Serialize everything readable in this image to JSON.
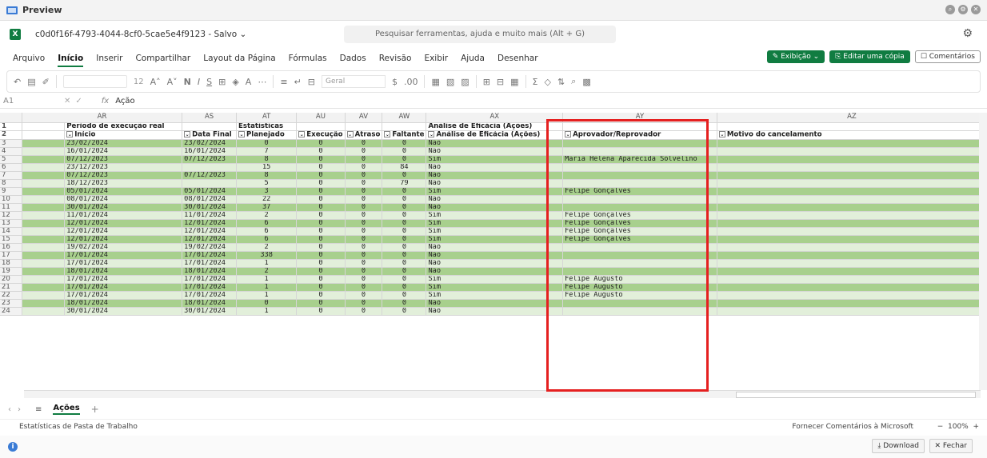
{
  "window": {
    "title": "Preview",
    "controls": [
      "zoom-icon",
      "settings-icon",
      "close-icon"
    ]
  },
  "file": {
    "name": "c0d0f16f-4793-4044-8cf0-5cae5e4f9123",
    "status": "Salvo",
    "app_icon": "X"
  },
  "search": {
    "placeholder": "Pesquisar ferramentas, ajuda e muito mais (Alt + G)"
  },
  "menu": {
    "items": [
      "Arquivo",
      "Início",
      "Inserir",
      "Compartilhar",
      "Layout da Página",
      "Fórmulas",
      "Dados",
      "Revisão",
      "Exibir",
      "Ajuda",
      "Desenhar"
    ],
    "active_index": 1,
    "exibicao": "Exibição",
    "editar": "Editar uma cópia",
    "comentarios": "Comentários"
  },
  "ribbon": {
    "font_size": "12",
    "number_format": "Geral"
  },
  "formula": {
    "cell": "A1",
    "fx": "fx",
    "value": "Ação"
  },
  "sheet": {
    "columns": [
      "AR",
      "AS",
      "AT",
      "AU",
      "AV",
      "AW",
      "AX",
      "AY",
      "AZ"
    ],
    "header1": {
      "ar": "Período de execução real",
      "at": "Estatísticas",
      "ax": "Análise de Eficácia (Ações)"
    },
    "header2": {
      "ar": "Início",
      "as": "Data Final",
      "at": "Planejado",
      "au": "Execução",
      "av": "Atraso",
      "aw": "Faltante",
      "ax": "Análise de Eficácia (Ações)",
      "ay": "Aprovador/Reprovador",
      "az": "Motivo do cancelamento"
    },
    "rows": [
      {
        "n": "3",
        "ar": "23/02/2024",
        "as": "23/02/2024",
        "at": "0",
        "au": "0",
        "av": "0",
        "aw": "0",
        "ax": "Não",
        "ay": ""
      },
      {
        "n": "4",
        "ar": "16/01/2024",
        "as": "16/01/2024",
        "at": "7",
        "au": "0",
        "av": "0",
        "aw": "0",
        "ax": "Não",
        "ay": ""
      },
      {
        "n": "5",
        "ar": "07/12/2023",
        "as": "07/12/2023",
        "at": "8",
        "au": "0",
        "av": "0",
        "aw": "0",
        "ax": "Sim",
        "ay": "Maria Helena Aparecida Solvelino"
      },
      {
        "n": "6",
        "ar": "23/12/2023",
        "as": "",
        "at": "15",
        "au": "0",
        "av": "0",
        "aw": "84",
        "ax": "Não",
        "ay": ""
      },
      {
        "n": "7",
        "ar": "07/12/2023",
        "as": "07/12/2023",
        "at": "8",
        "au": "0",
        "av": "0",
        "aw": "0",
        "ax": "Não",
        "ay": ""
      },
      {
        "n": "8",
        "ar": "18/12/2023",
        "as": "",
        "at": "5",
        "au": "0",
        "av": "0",
        "aw": "79",
        "ax": "Não",
        "ay": ""
      },
      {
        "n": "9",
        "ar": "05/01/2024",
        "as": "05/01/2024",
        "at": "3",
        "au": "0",
        "av": "0",
        "aw": "0",
        "ax": "Sim",
        "ay": "Felipe Gonçalves"
      },
      {
        "n": "10",
        "ar": "08/01/2024",
        "as": "08/01/2024",
        "at": "22",
        "au": "0",
        "av": "0",
        "aw": "0",
        "ax": "Não",
        "ay": ""
      },
      {
        "n": "11",
        "ar": "30/01/2024",
        "as": "30/01/2024",
        "at": "37",
        "au": "0",
        "av": "0",
        "aw": "0",
        "ax": "Não",
        "ay": ""
      },
      {
        "n": "12",
        "ar": "11/01/2024",
        "as": "11/01/2024",
        "at": "2",
        "au": "0",
        "av": "0",
        "aw": "0",
        "ax": "Sim",
        "ay": "Felipe Gonçalves"
      },
      {
        "n": "13",
        "ar": "12/01/2024",
        "as": "12/01/2024",
        "at": "6",
        "au": "0",
        "av": "0",
        "aw": "0",
        "ax": "Sim",
        "ay": "Felipe Gonçalves"
      },
      {
        "n": "14",
        "ar": "12/01/2024",
        "as": "12/01/2024",
        "at": "6",
        "au": "0",
        "av": "0",
        "aw": "0",
        "ax": "Sim",
        "ay": "Felipe Gonçalves"
      },
      {
        "n": "15",
        "ar": "12/01/2024",
        "as": "12/01/2024",
        "at": "6",
        "au": "0",
        "av": "0",
        "aw": "0",
        "ax": "Sim",
        "ay": "Felipe Gonçalves"
      },
      {
        "n": "16",
        "ar": "19/02/2024",
        "as": "19/02/2024",
        "at": "2",
        "au": "0",
        "av": "0",
        "aw": "0",
        "ax": "Não",
        "ay": ""
      },
      {
        "n": "17",
        "ar": "17/01/2024",
        "as": "17/01/2024",
        "at": "338",
        "au": "0",
        "av": "0",
        "aw": "0",
        "ax": "Não",
        "ay": ""
      },
      {
        "n": "18",
        "ar": "17/01/2024",
        "as": "17/01/2024",
        "at": "1",
        "au": "0",
        "av": "0",
        "aw": "0",
        "ax": "Não",
        "ay": ""
      },
      {
        "n": "19",
        "ar": "18/01/2024",
        "as": "18/01/2024",
        "at": "2",
        "au": "0",
        "av": "0",
        "aw": "0",
        "ax": "Não",
        "ay": ""
      },
      {
        "n": "20",
        "ar": "17/01/2024",
        "as": "17/01/2024",
        "at": "1",
        "au": "0",
        "av": "0",
        "aw": "0",
        "ax": "Sim",
        "ay": "Felipe Augusto"
      },
      {
        "n": "21",
        "ar": "17/01/2024",
        "as": "17/01/2024",
        "at": "1",
        "au": "0",
        "av": "0",
        "aw": "0",
        "ax": "Sim",
        "ay": "Felipe Augusto"
      },
      {
        "n": "22",
        "ar": "17/01/2024",
        "as": "17/01/2024",
        "at": "1",
        "au": "0",
        "av": "0",
        "aw": "0",
        "ax": "Sim",
        "ay": "Felipe Augusto"
      },
      {
        "n": "23",
        "ar": "18/01/2024",
        "as": "18/01/2024",
        "at": "0",
        "au": "0",
        "av": "0",
        "aw": "0",
        "ax": "Não",
        "ay": ""
      },
      {
        "n": "24",
        "ar": "30/01/2024",
        "as": "30/01/2024",
        "at": "1",
        "au": "0",
        "av": "0",
        "aw": "0",
        "ax": "Não",
        "ay": ""
      }
    ]
  },
  "tabs": {
    "sheet_name": "Ações"
  },
  "status": {
    "left": "Estatísticas de Pasta de Trabalho",
    "feedback": "Fornecer Comentários à Microsoft",
    "zoom": "100%"
  },
  "bottom": {
    "download": "Download",
    "close": "Fechar"
  },
  "colors": {
    "accent": "#107c41",
    "band_dark": "#a8d08d",
    "band_light": "#e2efda",
    "highlight": "#e52020"
  }
}
